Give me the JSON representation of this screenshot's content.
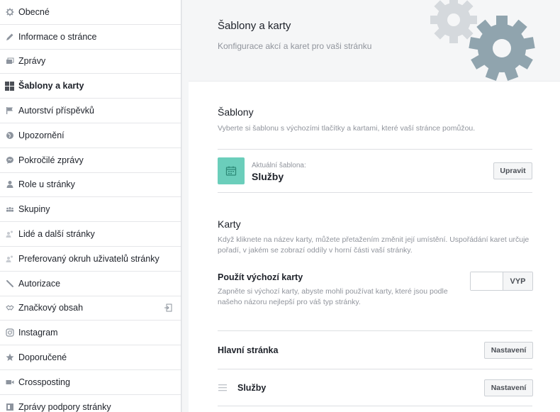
{
  "sidebar": {
    "items": [
      {
        "label": "Obecné",
        "icon": "gear-icon"
      },
      {
        "label": "Informace o stránce",
        "icon": "pencil-icon"
      },
      {
        "label": "Zprávy",
        "icon": "messages-icon"
      },
      {
        "label": "Šablony a karty",
        "icon": "grid-icon",
        "active": true
      },
      {
        "label": "Autorství příspěvků",
        "icon": "flag-icon"
      },
      {
        "label": "Upozornění",
        "icon": "globe-icon"
      },
      {
        "label": "Pokročilé zprávy",
        "icon": "chat-bubble-icon"
      },
      {
        "label": "Role u stránky",
        "icon": "person-icon"
      },
      {
        "label": "Skupiny",
        "icon": "group-icon"
      },
      {
        "label": "Lidé a další stránky",
        "icon": "people-icon"
      },
      {
        "label": "Preferovaný okruh uživatelů stránky",
        "icon": "people-icon"
      },
      {
        "label": "Autorizace",
        "icon": "wrench-icon"
      },
      {
        "label": "Značkový obsah",
        "icon": "handshake-icon"
      },
      {
        "label": "Instagram",
        "icon": "instagram-icon"
      },
      {
        "label": "Doporučené",
        "icon": "star-icon"
      },
      {
        "label": "Crossposting",
        "icon": "video-icon"
      },
      {
        "label": "Zprávy podpory stránky",
        "icon": "support-icon"
      }
    ]
  },
  "header": {
    "title": "Šablony a karty",
    "subtitle": "Konfigurace akcí a karet pro vaši stránku"
  },
  "templates": {
    "title": "Šablony",
    "description": "Vyberte si šablonu s výchozími tlačítky a kartami, které vaší stránce pomůžou.",
    "current_label": "Aktuální šablona:",
    "current_name": "Služby",
    "edit_button": "Upravit"
  },
  "tabs": {
    "title": "Karty",
    "description": "Když kliknete na název karty, můžete přetažením změnit její umístění. Uspořádání karet určuje pořadí, v jakém se zobrazí oddíly v horní části vaší stránky.",
    "default_title": "Použít výchozí karty",
    "default_description": "Zapněte si výchozí karty, abyste mohli používat karty, které jsou podle našeho názoru nejlepší pro váš typ stránky.",
    "toggle_label": "VYP",
    "rows": [
      {
        "label": "Hlavní stránka",
        "button": "Nastavení"
      },
      {
        "label": "Služby",
        "button": "Nastavení"
      }
    ]
  },
  "colors": {
    "template_icon_bg": "#6bcebb",
    "gear_dark": "#90a4ae",
    "gear_light": "#d5d9dd"
  }
}
